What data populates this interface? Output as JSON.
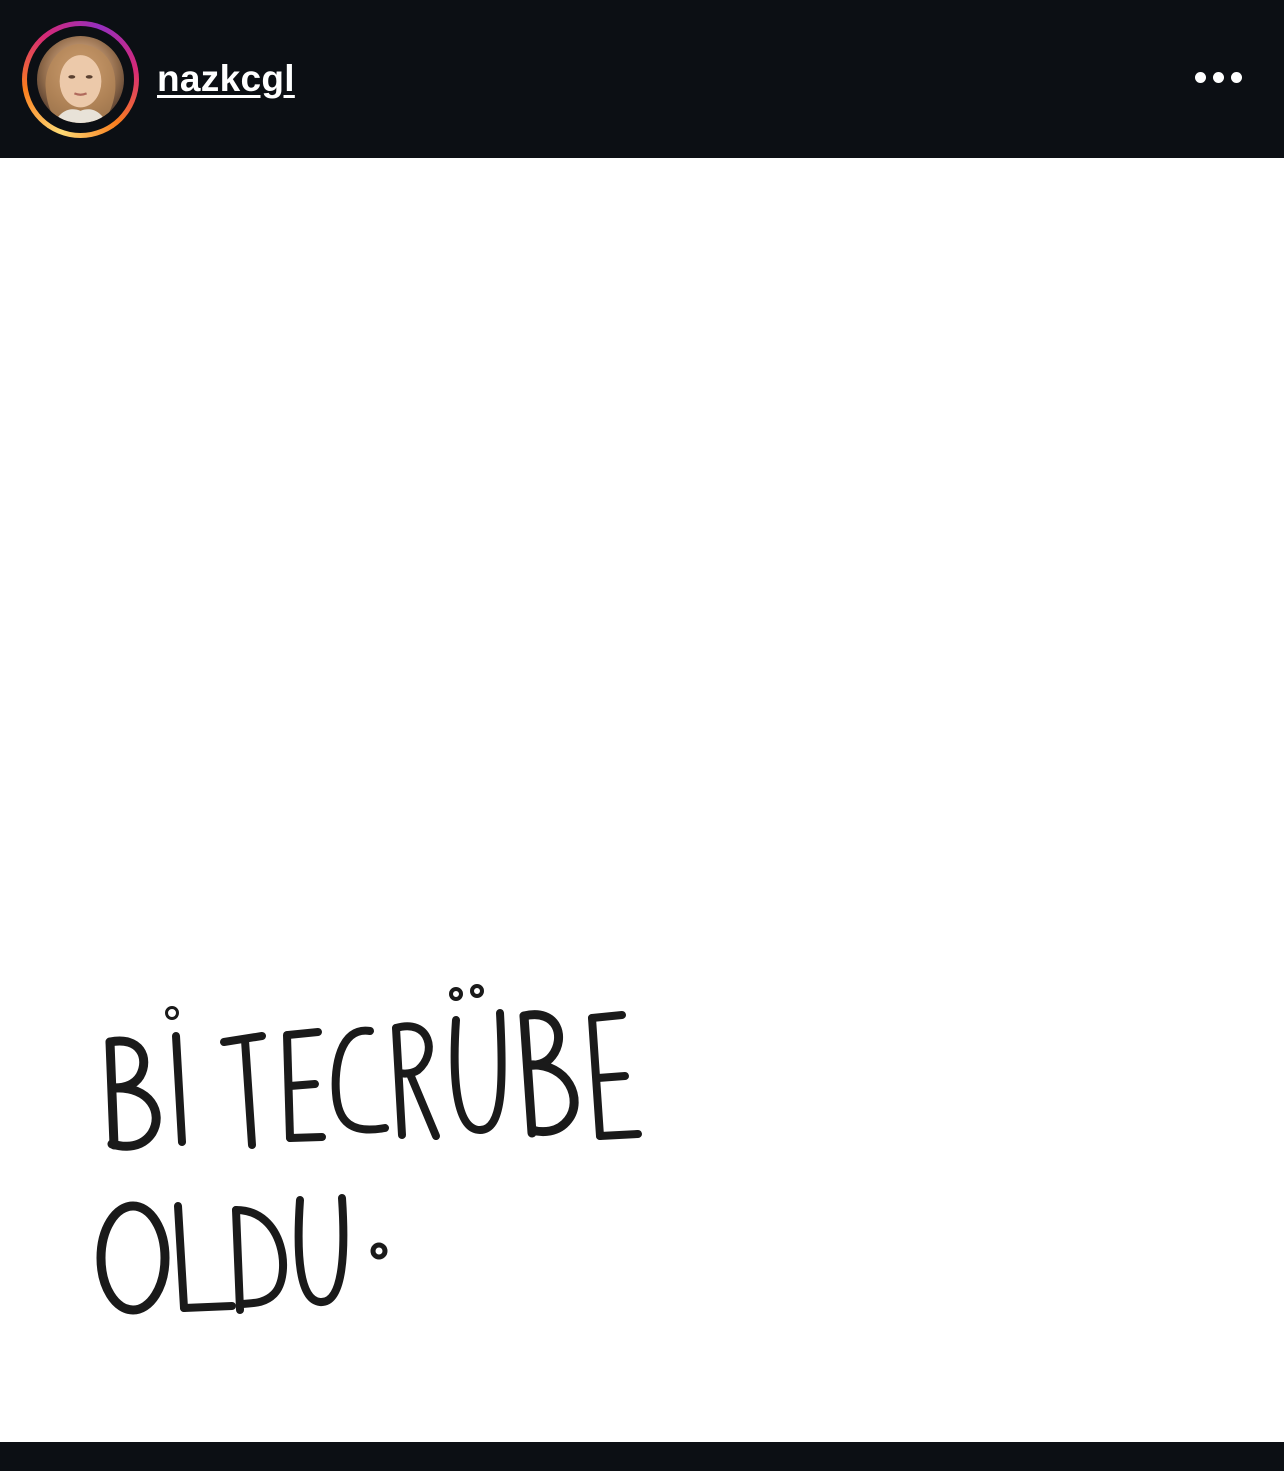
{
  "header": {
    "username": "nazkcgl",
    "avatar_icon": "profile-photo",
    "more_icon": "more-options-icon"
  },
  "post": {
    "handwritten_text": "Bİ TECRÜBE OLDU.",
    "background": "#ffffff",
    "ink_color": "#1a1a1a"
  },
  "colors": {
    "app_background": "#0c0f14",
    "story_ring": [
      "#feda75",
      "#fa7e1e",
      "#d62976",
      "#962fbf"
    ]
  }
}
